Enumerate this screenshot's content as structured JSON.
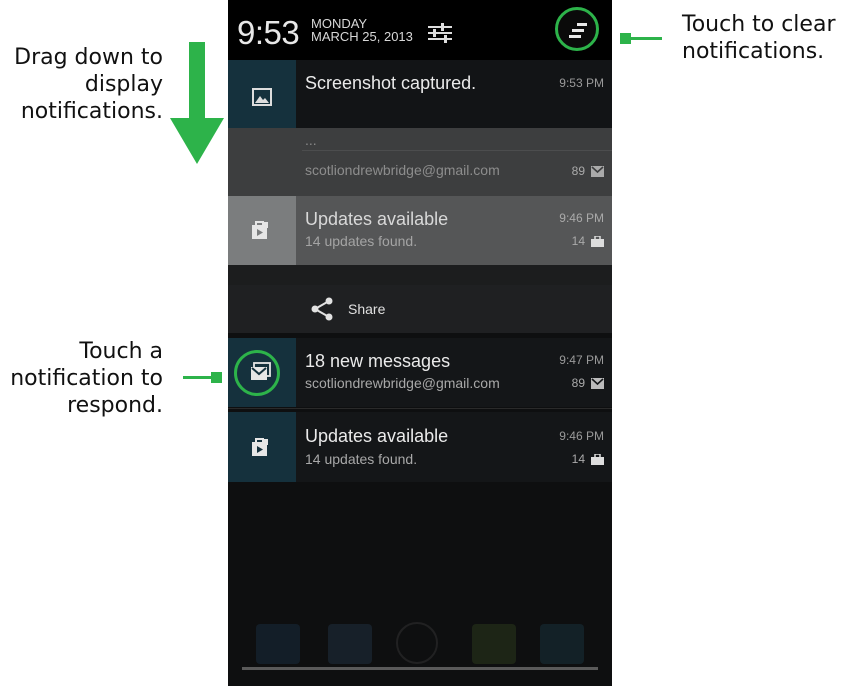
{
  "callouts": {
    "drag": "Drag down to display notifications.",
    "touch": "Touch a notification to respond.",
    "clear": "Touch to clear notifications."
  },
  "status_bar": {
    "time": "9:53",
    "day": "MONDAY",
    "date": "MARCH 25, 2013"
  },
  "notifications": {
    "screenshot": {
      "title": "Screenshot captured.",
      "time": "9:53 PM"
    },
    "gmail_dim": {
      "ellipsis": "...",
      "account": "scotliondrewbridge@gmail.com",
      "count": "89"
    },
    "updates_dim": {
      "title": "Updates available",
      "sub": "14 updates found.",
      "time": "9:46 PM",
      "count": "14"
    },
    "share": {
      "label": "Share"
    },
    "messages": {
      "title": "18 new messages",
      "sub": "scotliondrewbridge@gmail.com",
      "time": "9:47 PM",
      "count": "89"
    },
    "updates": {
      "title": "Updates available",
      "sub": "14 updates found.",
      "time": "9:46 PM",
      "count": "14"
    }
  },
  "colors": {
    "accent": "#2db34a",
    "icon_bg": "#15313d"
  }
}
